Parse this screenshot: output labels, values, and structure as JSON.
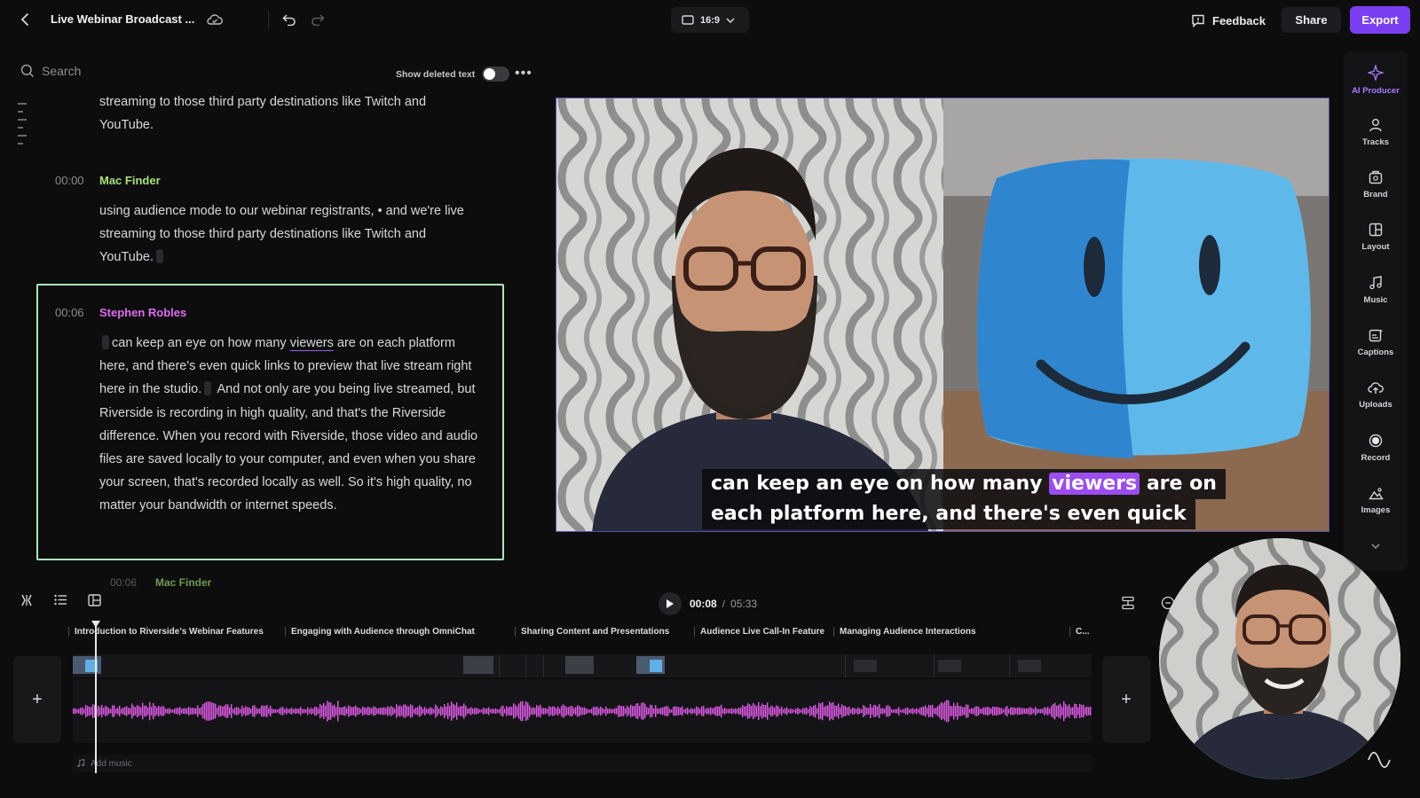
{
  "header": {
    "title": "Live Webinar Broadcast ...",
    "aspect_ratio": "16:9",
    "feedback_label": "Feedback",
    "share_label": "Share",
    "export_label": "Export",
    "accent_color": "#7b3ff2"
  },
  "transcript": {
    "search_placeholder": "Search",
    "show_deleted_label": "Show deleted text",
    "show_deleted_on": false,
    "prev_tail": "streaming to those third party destinations like Twitch and YouTube.",
    "blocks": [
      {
        "time": "00:00",
        "speaker": "Mac Finder",
        "text": "using audience mode to our webinar registrants, • and we're live streaming to those third party destinations like Twitch and YouTube."
      },
      {
        "time": "00:06",
        "speaker": "Stephen Robles",
        "text_a": "can keep an eye on how many ",
        "highlight_word": "viewers",
        "text_b": " are on each platform here, and there's even quick links to preview that live stream right here in the studio.",
        "text_c": " And not only are you being live streamed, but Riverside is recording in high quality, and that's the Riverside difference. When you record with Riverside, those video and audio files are saved locally to your computer, and even when you share your screen, that's recorded locally as well. So it's high quality, no matter your bandwidth or internet speeds."
      },
      {
        "time": "00:06",
        "speaker": "Mac Finder"
      }
    ]
  },
  "preview": {
    "caption_line1_a": "can keep an eye on how many",
    "caption_highlight": "viewers",
    "caption_line1_b": "are on",
    "caption_line2": "each platform here, and there's even quick"
  },
  "rail": {
    "items": [
      {
        "label": "AI Producer",
        "icon": "sparkle-icon"
      },
      {
        "label": "Tracks",
        "icon": "person-icon"
      },
      {
        "label": "Brand",
        "icon": "brand-icon"
      },
      {
        "label": "Layout",
        "icon": "layout-icon"
      },
      {
        "label": "Music",
        "icon": "music-note-icon"
      },
      {
        "label": "Captions",
        "icon": "captions-icon"
      },
      {
        "label": "Uploads",
        "icon": "upload-icon"
      },
      {
        "label": "Record",
        "icon": "record-icon"
      },
      {
        "label": "Images",
        "icon": "images-icon"
      }
    ]
  },
  "timeline": {
    "current_time": "00:08",
    "duration": "05:33",
    "chapters": [
      "Introduction to Riverside's Webinar Features",
      "Engaging with Audience through OmniChat",
      "Sharing Content and Presentations",
      "Audience Live Call-In Feature",
      "Managing Audience Interactions",
      "C..."
    ],
    "add_music_label": "Add music",
    "waveform_color": "#e05be8"
  }
}
